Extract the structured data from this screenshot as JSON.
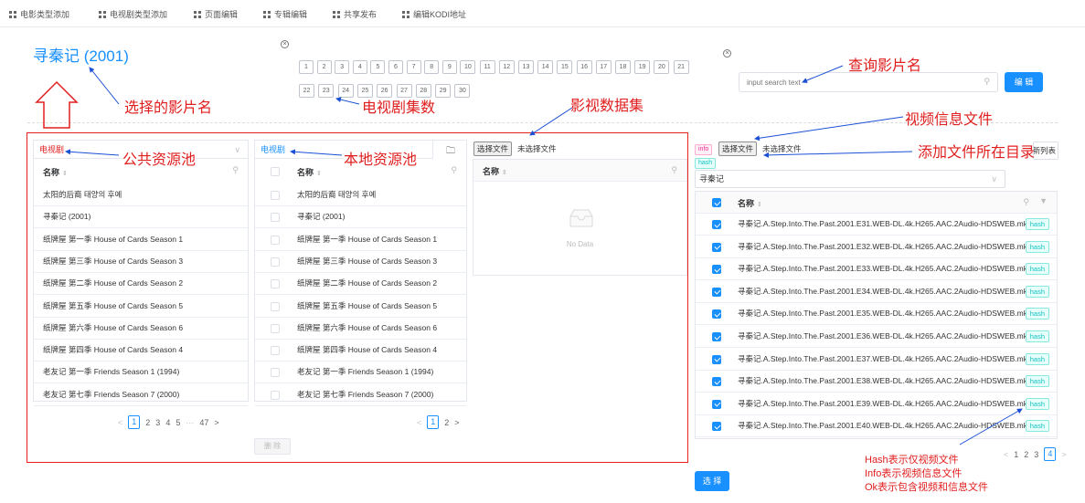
{
  "nav": [
    {
      "label": "电影类型添加"
    },
    {
      "label": "电视剧类型添加"
    },
    {
      "label": "页面编辑"
    },
    {
      "label": "专辑编辑"
    },
    {
      "label": "共享发布"
    },
    {
      "label": "编辑KODI地址"
    }
  ],
  "movie_title": "寻秦记 (2001)",
  "episodes_row1": [
    "1",
    "2",
    "3",
    "4",
    "5",
    "6",
    "7",
    "8",
    "9",
    "10",
    "11",
    "12",
    "13",
    "14",
    "15",
    "16",
    "17",
    "18",
    "19",
    "20",
    "21"
  ],
  "episodes_row2": [
    "22",
    "23",
    "24",
    "25",
    "26",
    "27",
    "28",
    "29",
    "30"
  ],
  "search": {
    "placeholder": "input search text",
    "edit_label": "编 辑"
  },
  "public_pool": {
    "select_value": "电视剧",
    "column": "名称",
    "rows": [
      "太阳的后裔 태양의 후예",
      "寻秦记 (2001)",
      "纸牌屋 第一季 House of Cards Season 1",
      "纸牌屋 第三季 House of Cards Season 3",
      "纸牌屋 第二季 House of Cards Season 2",
      "纸牌屋 第五季 House of Cards Season 5",
      "纸牌屋 第六季 House of Cards Season 6",
      "纸牌屋 第四季 House of Cards Season 4",
      "老友记 第一季 Friends Season 1 (1994)",
      "老友记 第七季 Friends Season 7 (2000)"
    ],
    "pager": {
      "prev": "<",
      "current": "1",
      "pages": [
        "2",
        "3",
        "4",
        "5"
      ],
      "ellipsis": "···",
      "last": "47",
      "next": ">"
    }
  },
  "local_pool": {
    "select_value": "电视剧",
    "column": "名称",
    "rows": [
      "太阳的后裔 태양의 후예",
      "寻秦记 (2001)",
      "纸牌屋 第一季 House of Cards Season 1",
      "纸牌屋 第三季 House of Cards Season 3",
      "纸牌屋 第二季 House of Cards Season 2",
      "纸牌屋 第五季 House of Cards Season 5",
      "纸牌屋 第六季 House of Cards Season 6",
      "纸牌屋 第四季 House of Cards Season 4",
      "老友记 第一季 Friends Season 1 (1994)",
      "老友记 第七季 Friends Season 7 (2000)"
    ],
    "pager": {
      "prev": "<",
      "current": "1",
      "pages": [
        "2"
      ],
      "next": ">"
    },
    "delete_label": "删 除"
  },
  "dataset": {
    "choose_file": "选择文件",
    "no_file": "未选择文件",
    "column": "名称",
    "empty": "No Data"
  },
  "video_info": {
    "tag_info": "info",
    "tag_hash": "hash",
    "choose_file": "选择文件",
    "no_file": "未选择文件",
    "refresh_label": "刷新列表",
    "folder_value": "寻秦记",
    "column": "名称",
    "rows": [
      {
        "name": "寻秦记.A.Step.Into.The.Past.2001.E31.WEB-DL.4k.H265.AAC.2Audio-HDSWEB.mkv",
        "tag": "hash"
      },
      {
        "name": "寻秦记.A.Step.Into.The.Past.2001.E32.WEB-DL.4k.H265.AAC.2Audio-HDSWEB.mkv",
        "tag": "hash"
      },
      {
        "name": "寻秦记.A.Step.Into.The.Past.2001.E33.WEB-DL.4k.H265.AAC.2Audio-HDSWEB.mkv",
        "tag": "hash"
      },
      {
        "name": "寻秦记.A.Step.Into.The.Past.2001.E34.WEB-DL.4k.H265.AAC.2Audio-HDSWEB.mkv",
        "tag": "hash"
      },
      {
        "name": "寻秦记.A.Step.Into.The.Past.2001.E35.WEB-DL.4k.H265.AAC.2Audio-HDSWEB.mkv",
        "tag": "hash"
      },
      {
        "name": "寻秦记.A.Step.Into.The.Past.2001.E36.WEB-DL.4k.H265.AAC.2Audio-HDSWEB.mkv",
        "tag": "hash"
      },
      {
        "name": "寻秦记.A.Step.Into.The.Past.2001.E37.WEB-DL.4k.H265.AAC.2Audio-HDSWEB.mkv",
        "tag": "hash"
      },
      {
        "name": "寻秦记.A.Step.Into.The.Past.2001.E38.WEB-DL.4k.H265.AAC.2Audio-HDSWEB.mkv",
        "tag": "hash"
      },
      {
        "name": "寻秦记.A.Step.Into.The.Past.2001.E39.WEB-DL.4k.H265.AAC.2Audio-HDSWEB.mkv",
        "tag": "hash"
      },
      {
        "name": "寻秦记.A.Step.Into.The.Past.2001.E40.WEB-DL.4k.H265.AAC.2Audio-HDSWEB.mkv",
        "tag": "hash"
      }
    ],
    "pager": {
      "prev": "<",
      "pages": [
        "1",
        "2",
        "3"
      ],
      "current": "4",
      "next": ">"
    }
  },
  "select_label": "选 择",
  "annotations": {
    "selected_title": "选择的影片名",
    "episodes": "电视剧集数",
    "search_title": "查询影片名",
    "dataset": "影视数据集",
    "video_info_file": "视频信息文件",
    "add_dir": "添加文件所在目录",
    "public_pool": "公共资源池",
    "local_pool": "本地资源池",
    "legend": [
      "Hash表示仅视频文件",
      "Info表示视频信息文件",
      "Ok表示包含视频和信息文件"
    ]
  },
  "colors": {
    "accent": "#1890ff",
    "annotation": "#e01e1e",
    "tag_hash": "#13c2c2",
    "tag_info": "#eb2f96"
  }
}
